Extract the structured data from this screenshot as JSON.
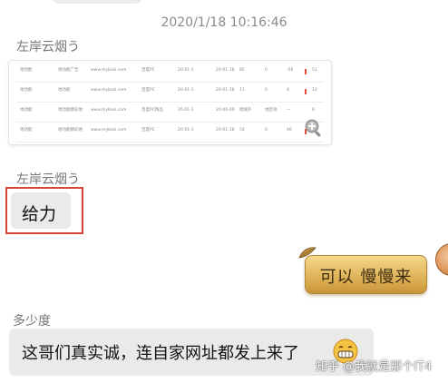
{
  "chat": {
    "timestamp": "2020/1/18 10:16:46",
    "messages": [
      {
        "sender": "左岸云烟う",
        "type": "image"
      },
      {
        "sender": "左岸云烟う",
        "text": "给力"
      },
      {
        "sender": "",
        "text": "可以 慢慢来",
        "style": "gold"
      },
      {
        "sender": "多少度",
        "text": "这哥们真实诚，连自家网址都发上来了"
      }
    ],
    "screenshot_rows": [
      [
        "地功能",
        "地功能广告",
        "www.mybosi.com",
        "百度PC",
        "20-01-1",
        "20-01-18",
        "85",
        "0",
        "-56",
        "51"
      ],
      [
        "地功能",
        "地功能",
        "www.mybosi.com",
        "百度PC",
        "20-01-1",
        "20-01-18",
        "11",
        "0",
        "4",
        "12"
      ],
      [
        "地功能",
        "地功能精彩地",
        "www.mybosi.com",
        "百度PC精品",
        "20-01-1",
        "20-00-00",
        "地域外",
        "地区地",
        "—",
        "8"
      ],
      [
        "地功能",
        "地功能精彩地",
        "www.mybosi.com",
        "百度PC",
        "20-01-1",
        "20-01-18",
        "54",
        "0",
        "46",
        "8"
      ]
    ]
  },
  "watermark": "知乎 @我就是那个IT4",
  "colors": {
    "highlight_box": "#d8453b",
    "bubble_gray": "#eaeaea",
    "bubble_gold": "#d9ab4e"
  },
  "icons": [
    "zoom-in-icon",
    "avatar",
    "grin-emoji-icon",
    "leaf-decoration-icon"
  ]
}
